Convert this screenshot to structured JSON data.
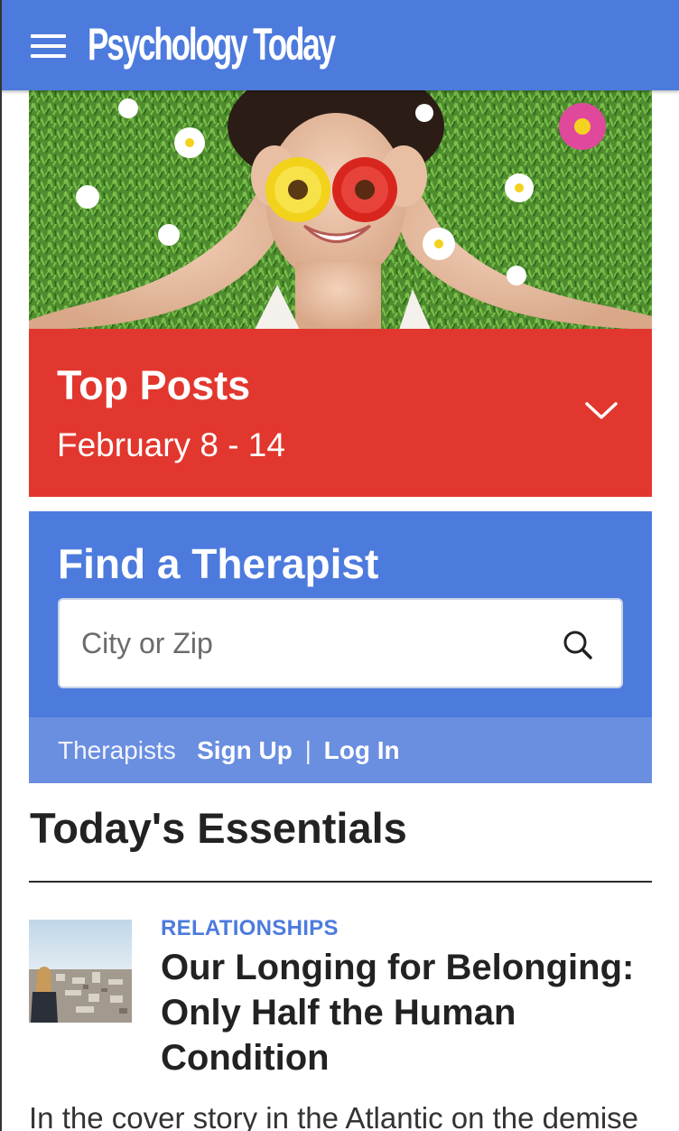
{
  "header": {
    "logo_text": "Psychology Today",
    "menu_icon": "hamburger-icon",
    "background": "#4d7bdd"
  },
  "hero": {
    "image": "woman-with-flowers-over-eyes-on-grass"
  },
  "top_posts": {
    "title": "Top Posts",
    "date_range": "February 8 - 14",
    "toggle_icon": "chevron-down-icon",
    "background": "#e1372e"
  },
  "therapist_finder": {
    "title": "Find a Therapist",
    "search": {
      "placeholder": "City or Zip",
      "value": "",
      "icon": "search-icon"
    },
    "footer": {
      "label": "Therapists",
      "sign_up": "Sign Up",
      "separator": "|",
      "log_in": "Log In"
    },
    "background": "#4d7bdd",
    "footer_background": "#6a8ee0"
  },
  "essentials": {
    "heading": "Today's Essentials",
    "articles": [
      {
        "category": "RELATIONSHIPS",
        "title": "Our Longing for Belonging: Only Half the Human Condition",
        "excerpt": "In the cover story in the Atlantic on the demise",
        "thumbnail": "woman-overlooking-city"
      }
    ]
  },
  "colors": {
    "brand_blue": "#4d7bdd",
    "accent_red": "#e1372e",
    "category_blue": "#4d7bdd"
  }
}
